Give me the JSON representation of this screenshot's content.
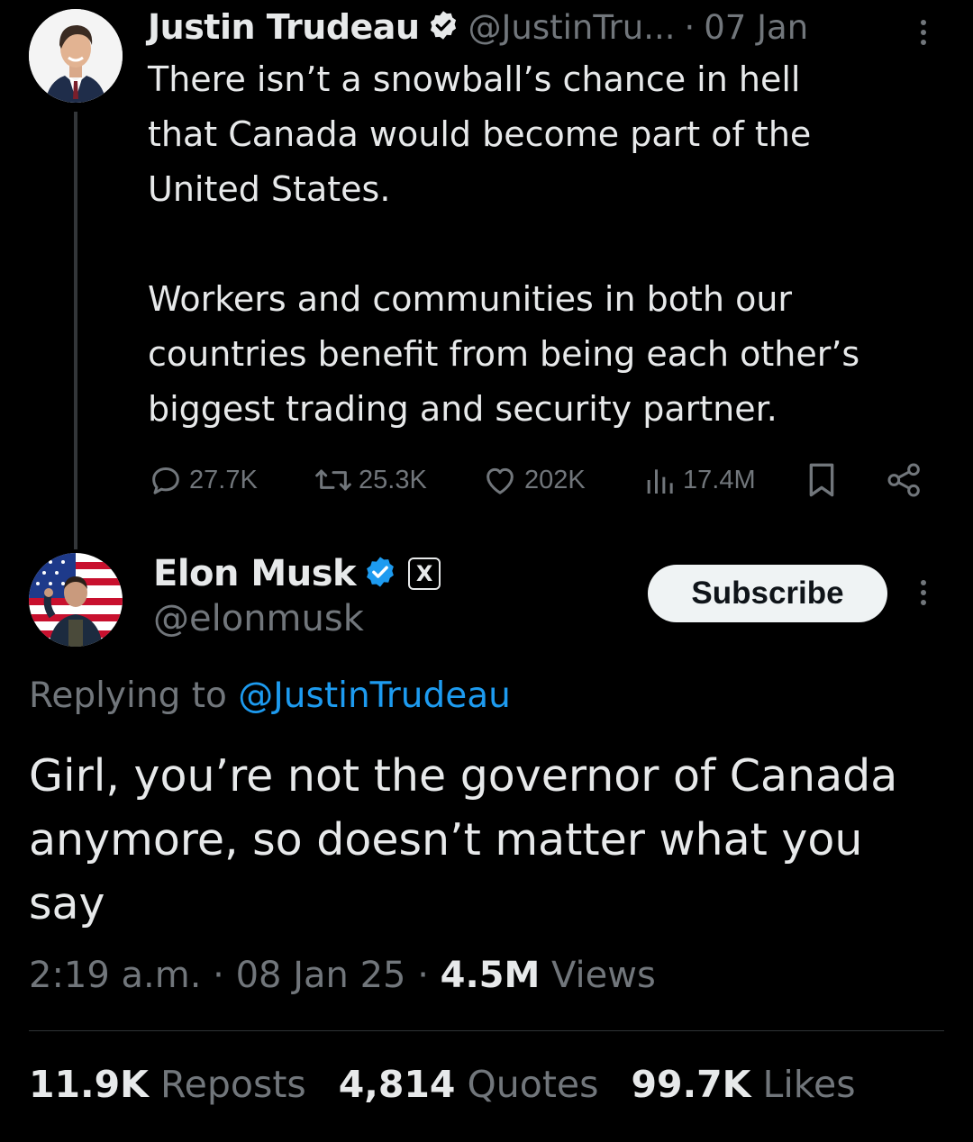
{
  "colors": {
    "background": "#000000",
    "primary_text": "#e7e9ea",
    "secondary_text": "#71767b",
    "link": "#1d9bf0",
    "verified_badge": "#1d9bf0"
  },
  "parent_tweet": {
    "avatar_icon": "avatar",
    "name": "Justin Trudeau",
    "verified_icon": "verified-badge-icon",
    "handle": "@JustinTru...",
    "separator": "·",
    "date": "07 Jan",
    "paragraphs": [
      [
        "There isn’t a snowball’s chance in hell",
        "that Canada would become part of the",
        "United States."
      ],
      [
        "Workers and communities in both our",
        "countries benefit from being each other’s",
        "biggest trading and security partner."
      ]
    ],
    "actions": {
      "replies": "27.7K",
      "reposts": "25.3K",
      "likes": "202K",
      "views": "17.4M"
    }
  },
  "reply_tweet": {
    "name": "Elon Musk",
    "verified_icon": "verified-badge-icon",
    "affiliate_badge": "X",
    "handle": "@elonmusk",
    "subscribe_label": "Subscribe",
    "replying_prefix": "Replying to",
    "replying_mention": "@JustinTrudeau",
    "text_lines": [
      "Girl, you’re not the governor of Canada",
      "anymore, so doesn’t matter what you",
      "say"
    ],
    "time": "2:19 a.m.",
    "separator": "·",
    "date": "08 Jan 25",
    "views_count": "4.5M",
    "views_label": "Views",
    "stats": {
      "reposts_count": "11.9K",
      "reposts_label": "Reposts",
      "quotes_count": "4,814",
      "quotes_label": "Quotes",
      "likes_count": "99.7K",
      "likes_label": "Likes"
    }
  }
}
